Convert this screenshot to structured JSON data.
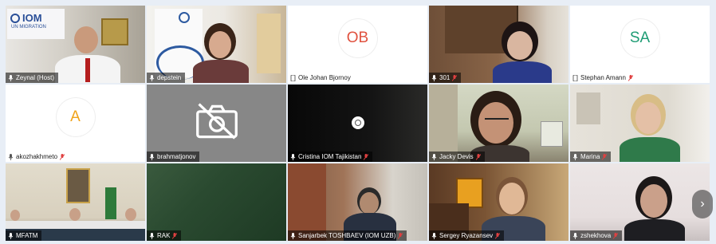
{
  "participants": [
    {
      "name": "Zeynal (Host)",
      "mic": "on",
      "type": "video"
    },
    {
      "name": "depstein",
      "mic": "on",
      "type": "video",
      "active": true
    },
    {
      "name": "Ole Johan Bjornoy",
      "mic": "none",
      "type": "avatar",
      "initials": "OB",
      "initials_color": "#e0523f"
    },
    {
      "name": "301",
      "mic": "muted",
      "type": "video"
    },
    {
      "name": "Stephan Amann",
      "mic": "muted",
      "type": "avatar",
      "initials": "SA",
      "initials_color": "#1e9c74"
    },
    {
      "name": "akozhakhmeto",
      "mic": "muted",
      "type": "avatar",
      "initials": "A",
      "initials_color": "#f0a31a"
    },
    {
      "name": "brahmatjonov",
      "mic": "on",
      "type": "camera-off"
    },
    {
      "name": "Cristina IOM Tajikistan",
      "mic": "muted",
      "type": "video"
    },
    {
      "name": "Jacky Devis",
      "mic": "muted",
      "type": "video"
    },
    {
      "name": "Marina",
      "mic": "muted",
      "type": "video"
    },
    {
      "name": "MFATM",
      "mic": "on",
      "type": "video"
    },
    {
      "name": "RAK",
      "mic": "muted",
      "type": "video"
    },
    {
      "name": "Sanjarbek TOSHBAEV (IOM UZB)",
      "mic": "muted",
      "type": "video"
    },
    {
      "name": "Sergey Ryazansev",
      "mic": "muted",
      "type": "video"
    },
    {
      "name": "zshekhova",
      "mic": "muted",
      "type": "video"
    }
  ],
  "banner": {
    "logo_text": "IOM",
    "subtitle": "UN MIGRATION"
  },
  "icons": {
    "mic": "microphone-icon",
    "mic_muted": "microphone-muted-icon",
    "camera_off": "camera-off-icon",
    "next": "chevron-right-icon"
  },
  "next_label": "›",
  "colors": {
    "active_border": "#3aa0d8",
    "muted": "#e04040"
  }
}
